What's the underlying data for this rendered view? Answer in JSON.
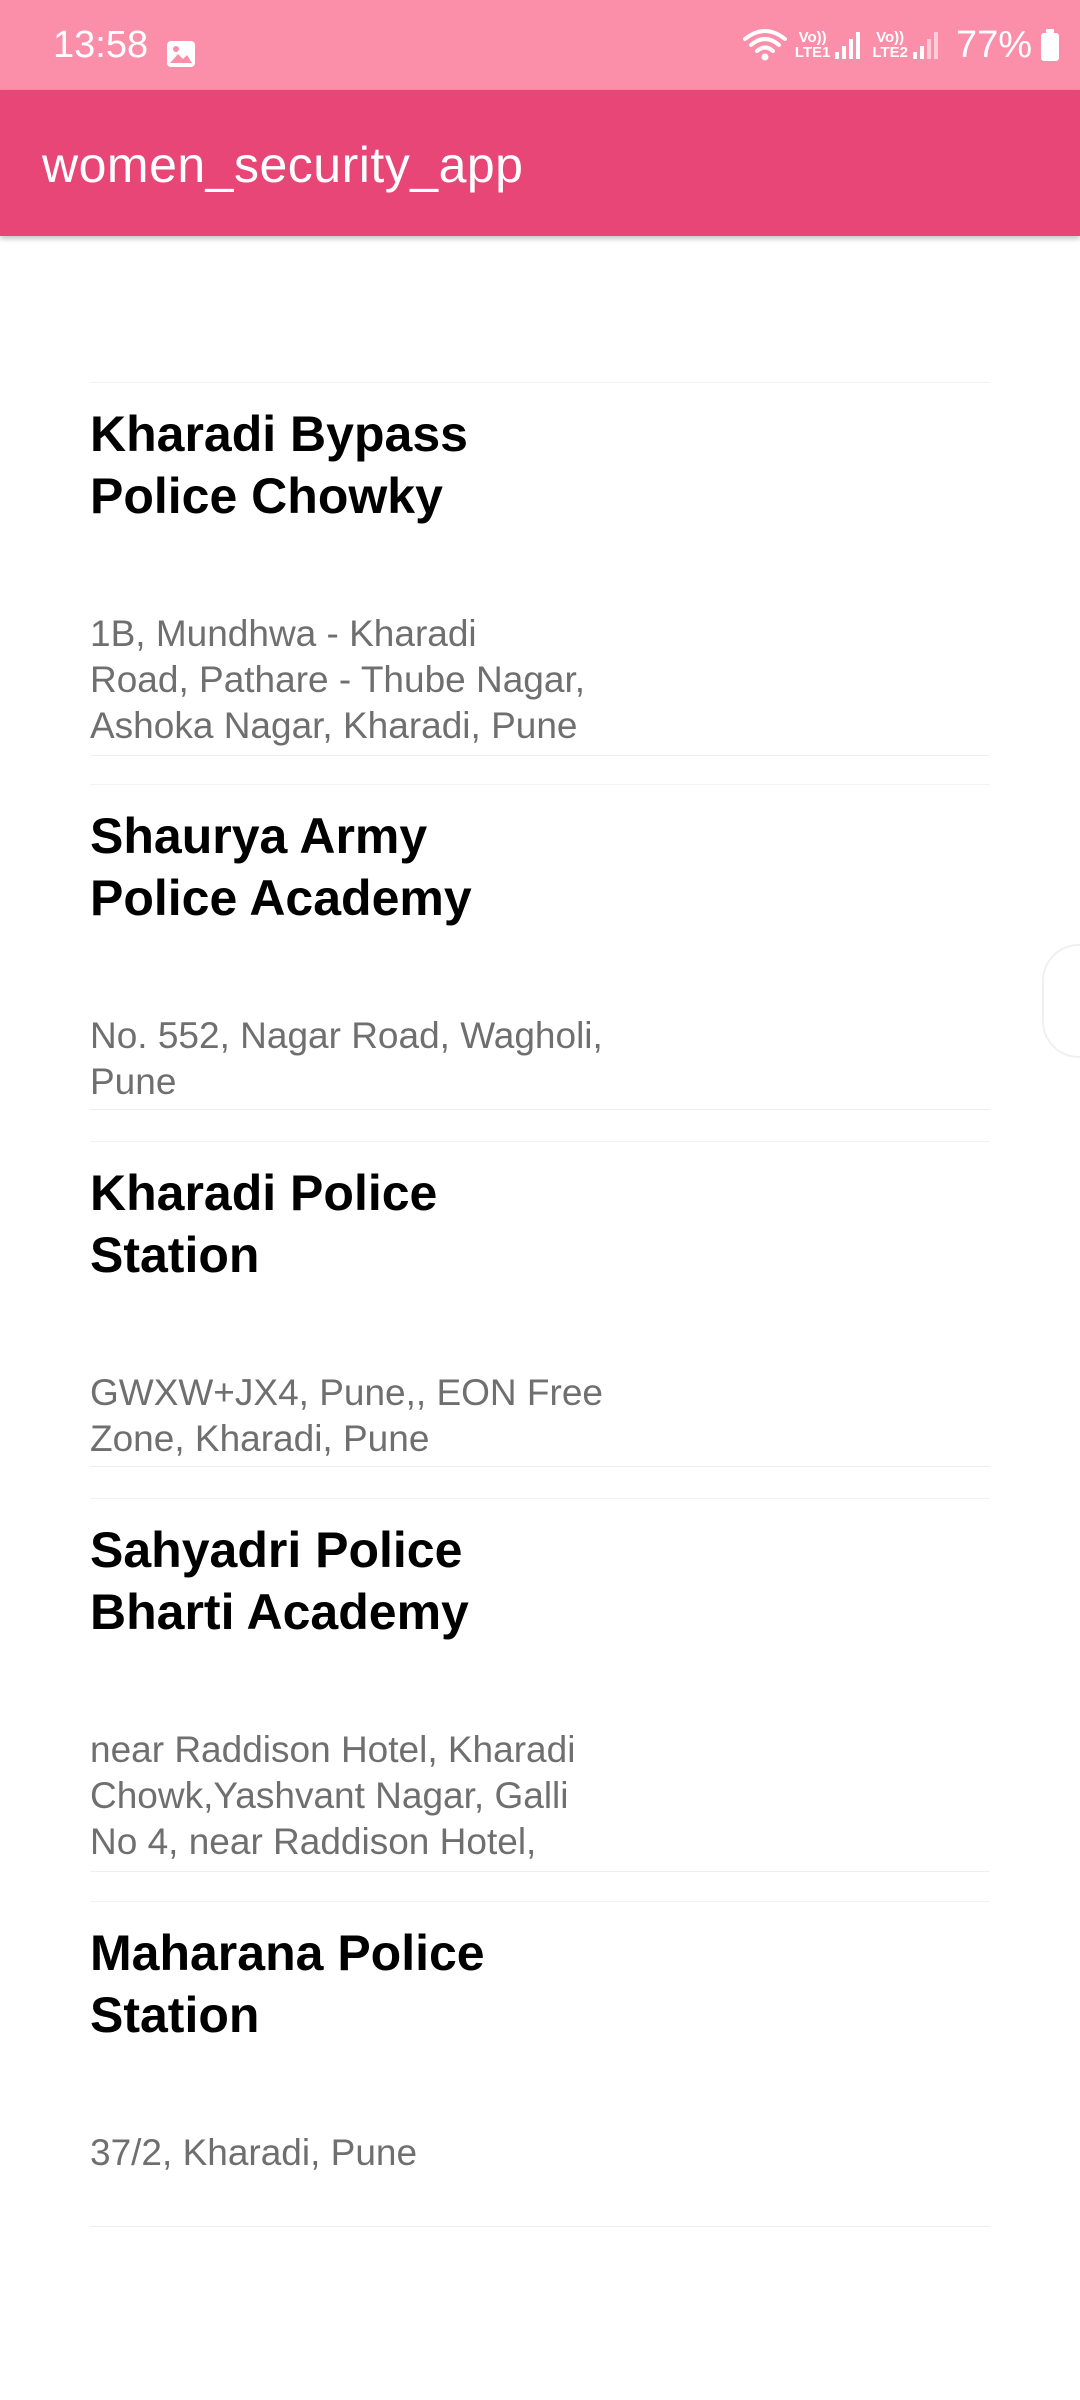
{
  "status_bar": {
    "time": "13:58",
    "gallery_icon": "image-icon",
    "sim1_top": "Vo))",
    "sim1_bottom": "LTE1",
    "sim2_top": "Vo))",
    "sim2_bottom": "LTE2",
    "battery": "77%"
  },
  "app_bar": {
    "title": "women_security_app",
    "color": "#e84677"
  },
  "colors": {
    "status_bar": "#fb8ea8",
    "address_text": "#6f6f6f"
  },
  "stations": [
    {
      "name": "Kharadi Bypass\nPolice Chowky",
      "address": "1B, Mundhwa - Kharadi\nRoad, Pathare - Thube Nagar,\nAshoka Nagar, Kharadi, Pune"
    },
    {
      "name": "Shaurya Army\nPolice Academy",
      "address": "No. 552, Nagar Road, Wagholi,\nPune"
    },
    {
      "name": "Kharadi Police\nStation",
      "address": "GWXW+JX4, Pune,, EON Free\nZone, Kharadi, Pune"
    },
    {
      "name": "Sahyadri Police\nBharti Academy",
      "address": "near Raddison Hotel, Kharadi\nChowk,Yashvant Nagar, Galli\nNo 4, near Raddison Hotel,"
    },
    {
      "name": "Maharana Police\nStation",
      "address": "37/2, Kharadi, Pune"
    }
  ]
}
